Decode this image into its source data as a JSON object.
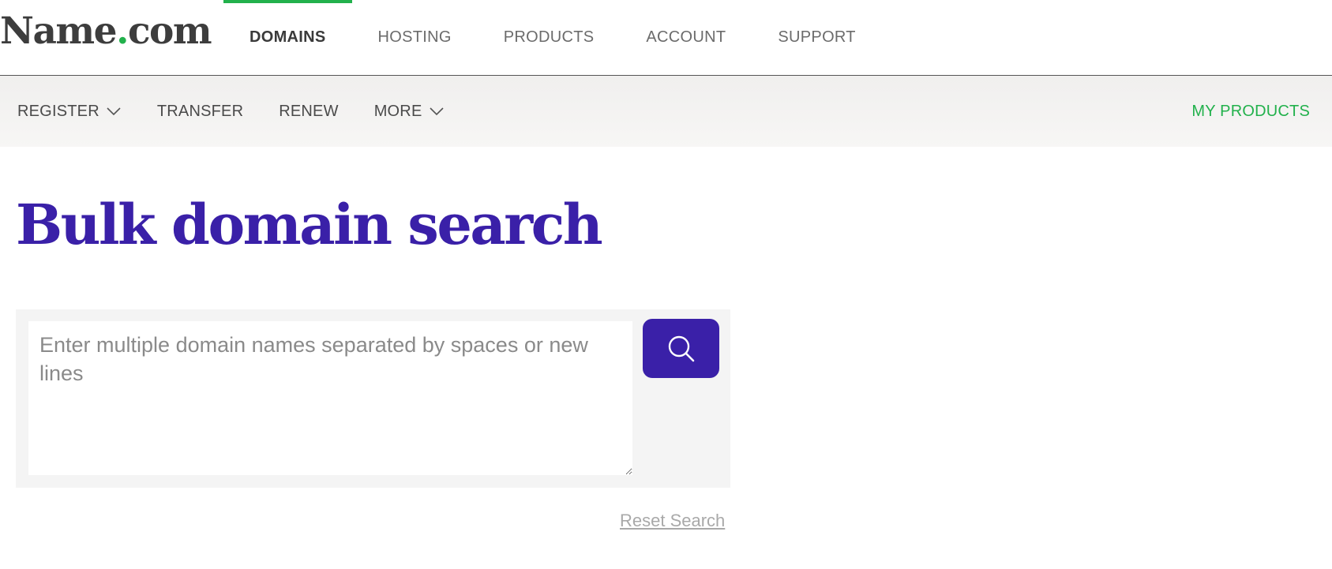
{
  "brand": {
    "logo_left": "Name",
    "logo_dot": ".",
    "logo_right": "com",
    "accent_color": "#22b14c",
    "primary_color": "#3a20a8"
  },
  "top_nav": {
    "items": [
      {
        "label": "DOMAINS",
        "active": true
      },
      {
        "label": "HOSTING",
        "active": false
      },
      {
        "label": "PRODUCTS",
        "active": false
      },
      {
        "label": "ACCOUNT",
        "active": false
      },
      {
        "label": "SUPPORT",
        "active": false
      }
    ]
  },
  "sub_nav": {
    "items": [
      {
        "label": "REGISTER",
        "icon": "chevron-down-icon"
      },
      {
        "label": "TRANSFER"
      },
      {
        "label": "RENEW"
      },
      {
        "label": "MORE",
        "icon": "chevron-down-icon"
      }
    ],
    "my_products": "MY PRODUCTS"
  },
  "main": {
    "title": "Bulk domain search",
    "search": {
      "placeholder": "Enter multiple domain names separated by spaces or new lines",
      "value": "",
      "button_icon": "search-icon"
    },
    "reset_label": "Reset Search"
  }
}
